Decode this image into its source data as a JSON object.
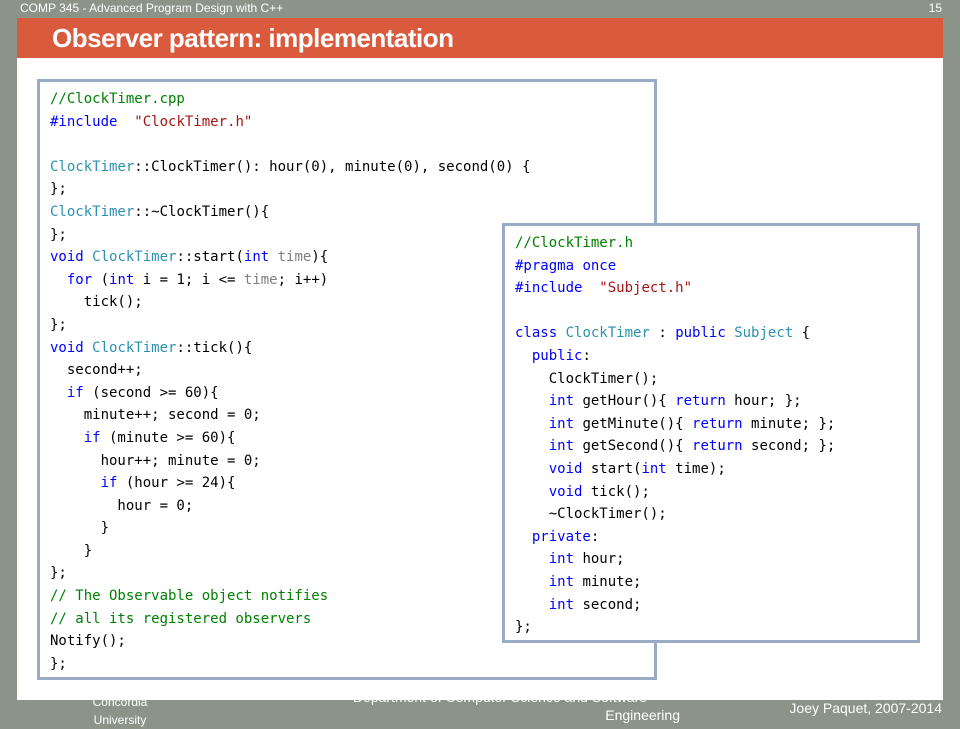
{
  "header": {
    "course": "COMP 345 - Advanced Program Design with C++",
    "slide_number": "15"
  },
  "title": "Observer pattern: implementation",
  "code_cpp": [
    [
      [
        "cm",
        "//ClockTimer.cpp"
      ]
    ],
    [
      [
        "kw",
        "#include"
      ],
      [
        "",
        "  "
      ],
      [
        "str",
        "\"ClockTimer.h\""
      ]
    ],
    [],
    [
      [
        "cls",
        "ClockTimer"
      ],
      [
        "",
        "::ClockTimer(): hour(0), minute(0), second(0) {"
      ]
    ],
    [
      [
        "",
        "};"
      ]
    ],
    [
      [
        "cls",
        "ClockTimer"
      ],
      [
        "",
        "::~ClockTimer(){"
      ]
    ],
    [
      [
        "",
        "};"
      ]
    ],
    [
      [
        "kw",
        "void"
      ],
      [
        "",
        " "
      ],
      [
        "cls",
        "ClockTimer"
      ],
      [
        "",
        "::start("
      ],
      [
        "kw",
        "int"
      ],
      [
        "",
        " "
      ],
      [
        "par",
        "time"
      ],
      [
        "",
        "){"
      ]
    ],
    [
      [
        "",
        "  "
      ],
      [
        "kw",
        "for"
      ],
      [
        "",
        " ("
      ],
      [
        "kw",
        "int"
      ],
      [
        "",
        " i = 1; i <= "
      ],
      [
        "par",
        "time"
      ],
      [
        "",
        "; i++)"
      ]
    ],
    [
      [
        "",
        "    tick();"
      ]
    ],
    [
      [
        "",
        "};"
      ]
    ],
    [
      [
        "kw",
        "void"
      ],
      [
        "",
        " "
      ],
      [
        "cls",
        "ClockTimer"
      ],
      [
        "",
        "::tick(){"
      ]
    ],
    [
      [
        "",
        "  second++;"
      ]
    ],
    [
      [
        "",
        "  "
      ],
      [
        "kw",
        "if"
      ],
      [
        "",
        " (second >= 60){"
      ]
    ],
    [
      [
        "",
        "    minute++; second = 0;"
      ]
    ],
    [
      [
        "",
        "    "
      ],
      [
        "kw",
        "if"
      ],
      [
        "",
        " (minute >= 60){"
      ]
    ],
    [
      [
        "",
        "      hour++; minute = 0;"
      ]
    ],
    [
      [
        "",
        "      "
      ],
      [
        "kw",
        "if"
      ],
      [
        "",
        " (hour >= 24){"
      ]
    ],
    [
      [
        "",
        "        hour = 0;"
      ]
    ],
    [
      [
        "",
        "      }"
      ]
    ],
    [
      [
        "",
        "    }"
      ]
    ],
    [
      [
        "",
        "};"
      ]
    ],
    [
      [
        "cm",
        "// The Observable object notifies"
      ]
    ],
    [
      [
        "cm",
        "// all its registered observers"
      ]
    ],
    [
      [
        "",
        "Notify();"
      ]
    ],
    [
      [
        "",
        "};"
      ]
    ]
  ],
  "code_h": [
    [
      [
        "cm",
        "//ClockTimer.h"
      ]
    ],
    [
      [
        "kw",
        "#pragma"
      ],
      [
        "",
        " "
      ],
      [
        "kw",
        "once"
      ]
    ],
    [
      [
        "kw",
        "#include"
      ],
      [
        "",
        "  "
      ],
      [
        "str",
        "\"Subject.h\""
      ]
    ],
    [],
    [
      [
        "kw",
        "class"
      ],
      [
        "",
        " "
      ],
      [
        "cls",
        "ClockTimer"
      ],
      [
        "",
        " : "
      ],
      [
        "kw",
        "public"
      ],
      [
        "",
        " "
      ],
      [
        "cls",
        "Subject"
      ],
      [
        "",
        " {"
      ]
    ],
    [
      [
        "",
        "  "
      ],
      [
        "kw",
        "public"
      ],
      [
        "",
        ":"
      ]
    ],
    [
      [
        "",
        "    ClockTimer();"
      ]
    ],
    [
      [
        "",
        "    "
      ],
      [
        "kw",
        "int"
      ],
      [
        "",
        " getHour(){ "
      ],
      [
        "kw",
        "return"
      ],
      [
        "",
        " hour; };"
      ]
    ],
    [
      [
        "",
        "    "
      ],
      [
        "kw",
        "int"
      ],
      [
        "",
        " getMinute(){ "
      ],
      [
        "kw",
        "return"
      ],
      [
        "",
        " minute; };"
      ]
    ],
    [
      [
        "",
        "    "
      ],
      [
        "kw",
        "int"
      ],
      [
        "",
        " getSecond(){ "
      ],
      [
        "kw",
        "return"
      ],
      [
        "",
        " second; };"
      ]
    ],
    [
      [
        "",
        "    "
      ],
      [
        "kw",
        "void"
      ],
      [
        "",
        " start("
      ],
      [
        "kw",
        "int"
      ],
      [
        "",
        " time);"
      ]
    ],
    [
      [
        "",
        "    "
      ],
      [
        "kw",
        "void"
      ],
      [
        "",
        " tick();"
      ]
    ],
    [
      [
        "",
        "    ~ClockTimer();"
      ]
    ],
    [
      [
        "",
        "  "
      ],
      [
        "kw",
        "private"
      ],
      [
        "",
        ":"
      ]
    ],
    [
      [
        "",
        "    "
      ],
      [
        "kw",
        "int"
      ],
      [
        "",
        " hour;"
      ]
    ],
    [
      [
        "",
        "    "
      ],
      [
        "kw",
        "int"
      ],
      [
        "",
        " minute;"
      ]
    ],
    [
      [
        "",
        "    "
      ],
      [
        "kw",
        "int"
      ],
      [
        "",
        " second;"
      ]
    ],
    [
      [
        "",
        "};"
      ]
    ]
  ],
  "footer": {
    "university_line1": "Concordia",
    "university_line2": "University",
    "department_line1": "Department of Computer Science and Software",
    "department_line2": "Engineering",
    "author": "Joey Paquet, 2007-2014"
  }
}
